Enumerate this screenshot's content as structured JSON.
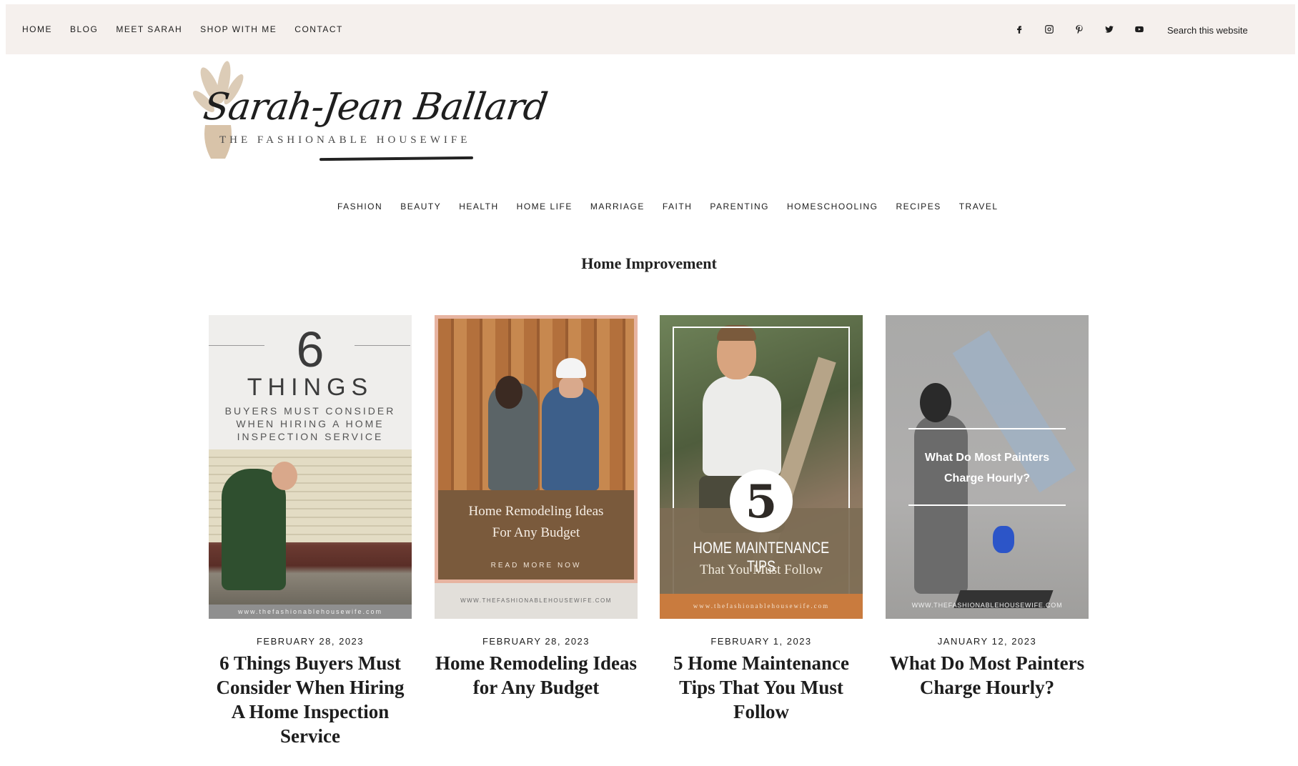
{
  "topnav": {
    "items": [
      {
        "label": "HOME"
      },
      {
        "label": "BLOG"
      },
      {
        "label": "MEET SARAH"
      },
      {
        "label": "SHOP WITH ME"
      },
      {
        "label": "CONTACT"
      }
    ],
    "social": [
      "facebook-icon",
      "instagram-icon",
      "pinterest-icon",
      "twitter-icon",
      "youtube-icon"
    ],
    "search_placeholder": "Search this website"
  },
  "logo": {
    "name": "Sarah-Jean Ballard",
    "tagline": "THE FASHIONABLE HOUSEWIFE"
  },
  "catnav": {
    "items": [
      {
        "label": "FASHION"
      },
      {
        "label": "BEAUTY"
      },
      {
        "label": "HEALTH"
      },
      {
        "label": "HOME LIFE"
      },
      {
        "label": "MARRIAGE"
      },
      {
        "label": "FAITH"
      },
      {
        "label": "PARENTING"
      },
      {
        "label": "HOMESCHOOLING"
      },
      {
        "label": "RECIPES"
      },
      {
        "label": "TRAVEL"
      }
    ]
  },
  "archive": {
    "title": "Home Improvement"
  },
  "posts": [
    {
      "date": "FEBRUARY 28, 2023",
      "title": "6 Things Buyers Must Consider When Hiring A Home Inspection Service",
      "thumb": {
        "number": "6",
        "headline": "THINGS",
        "sub1": "BUYERS MUST CONSIDER",
        "sub2": "WHEN HIRING A HOME",
        "sub3": "INSPECTION SERVICE",
        "footer": "www.thefashionablehousewife.com"
      }
    },
    {
      "date": "FEBRUARY 28, 2023",
      "title": "Home Remodeling Ideas for Any Budget",
      "thumb": {
        "line1": "Home Remodeling Ideas",
        "line2": "For Any Budget",
        "cta": "READ MORE NOW",
        "footer": "WWW.THEFASHIONABLEHOUSEWIFE.COM"
      }
    },
    {
      "date": "FEBRUARY 1, 2023",
      "title": "5 Home Maintenance Tips That You Must Follow",
      "thumb": {
        "number": "5",
        "headline": "HOME MAINTENANCE TIPS",
        "sub": "That You Must Follow",
        "footer": "www.thefashionablehousewife.com"
      }
    },
    {
      "date": "JANUARY 12, 2023",
      "title": "What Do Most Painters Charge Hourly?",
      "thumb": {
        "line1": "What Do Most Painters",
        "line2": "Charge Hourly?",
        "footer": "WWW.THEFASHIONABLEHOUSEWIFE.COM"
      }
    }
  ],
  "colors": {
    "topbar_bg": "#f5f0ed",
    "text": "#1d1d1d",
    "thumb2_panel": "#7a5a3c",
    "thumb3_footer": "#c97b3e"
  }
}
